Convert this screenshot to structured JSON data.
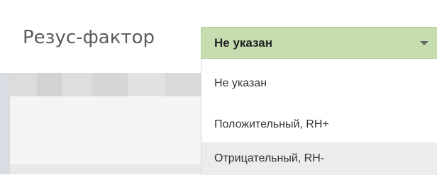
{
  "field": {
    "label": "Резус-фактор"
  },
  "select": {
    "value": "Не указан",
    "selected_bg": "#c6ddb0",
    "arrow_icon": "caret-down-icon"
  },
  "options": [
    {
      "label": "Не указан"
    },
    {
      "label": "Положительный, RH+"
    },
    {
      "label": "Отрицательный, RH-",
      "hovered": true
    }
  ]
}
